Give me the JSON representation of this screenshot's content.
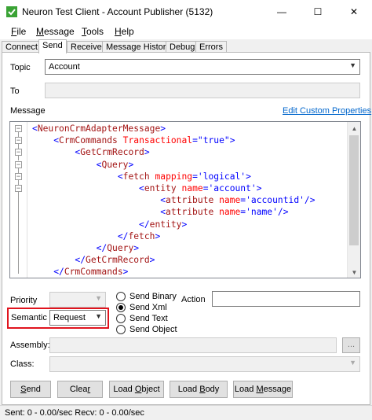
{
  "window": {
    "title": "Neuron Test Client - Account Publisher (5132)",
    "min_glyph": "—",
    "max_glyph": "☐",
    "close_glyph": "✕"
  },
  "menu": [
    {
      "label": "File",
      "key": "F",
      "rest": "ile"
    },
    {
      "label": "Message",
      "key": "M",
      "rest": "essage"
    },
    {
      "label": "Tools",
      "key": "T",
      "rest": "ools"
    },
    {
      "label": "Help",
      "key": "H",
      "rest": "elp"
    }
  ],
  "tabs": [
    "Connect",
    "Send",
    "Receive",
    "Message History",
    "Debug",
    "Errors"
  ],
  "active_tab": "Send",
  "form": {
    "topic_label": "Topic",
    "topic_value": "Account",
    "to_label": "To",
    "message_label": "Message",
    "edit_link": "Edit Custom Properties",
    "priority_label": "Priority",
    "semantic_label": "Semantic",
    "semantic_value": "Request",
    "action_label": "Action",
    "assembly_label": "Assembly:",
    "class_label": "Class:",
    "browse_label": "..."
  },
  "send_options": [
    {
      "label": "Send Binary",
      "checked": false
    },
    {
      "label": "Send Xml",
      "checked": true
    },
    {
      "label": "Send Text",
      "checked": false
    },
    {
      "label": "Send Object",
      "checked": false
    }
  ],
  "xml_lines": [
    {
      "indent": 0,
      "tokens": [
        [
          "tb",
          "<"
        ],
        [
          "tn",
          "NeuronCrmAdapterMessage"
        ],
        [
          "tb",
          ">"
        ]
      ]
    },
    {
      "indent": 1,
      "tokens": [
        [
          "tb",
          "<"
        ],
        [
          "tn",
          "CrmCommands"
        ],
        [
          "tx",
          " "
        ],
        [
          "an",
          "Transactional"
        ],
        [
          "tb",
          "=\""
        ],
        [
          "av",
          "true"
        ],
        [
          "tb",
          "\">"
        ]
      ]
    },
    {
      "indent": 2,
      "tokens": [
        [
          "tb",
          "<"
        ],
        [
          "tn",
          "GetCrmRecord"
        ],
        [
          "tb",
          ">"
        ]
      ]
    },
    {
      "indent": 3,
      "tokens": [
        [
          "tb",
          "<"
        ],
        [
          "tn",
          "Query"
        ],
        [
          "tb",
          ">"
        ]
      ]
    },
    {
      "indent": 4,
      "tokens": [
        [
          "tb",
          "<"
        ],
        [
          "tn",
          "fetch"
        ],
        [
          "tx",
          " "
        ],
        [
          "an",
          "mapping"
        ],
        [
          "tb",
          "='"
        ],
        [
          "av",
          "logical"
        ],
        [
          "tb",
          "'>"
        ]
      ]
    },
    {
      "indent": 5,
      "tokens": [
        [
          "tb",
          "<"
        ],
        [
          "tn",
          "entity"
        ],
        [
          "tx",
          " "
        ],
        [
          "an",
          "name"
        ],
        [
          "tb",
          "='"
        ],
        [
          "av",
          "account"
        ],
        [
          "tb",
          "'>"
        ]
      ]
    },
    {
      "indent": 6,
      "tokens": [
        [
          "tb",
          "<"
        ],
        [
          "tn",
          "attribute"
        ],
        [
          "tx",
          " "
        ],
        [
          "an",
          "name"
        ],
        [
          "tb",
          "='"
        ],
        [
          "av",
          "accountid"
        ],
        [
          "tb",
          "'/>"
        ]
      ]
    },
    {
      "indent": 6,
      "tokens": [
        [
          "tb",
          "<"
        ],
        [
          "tn",
          "attribute"
        ],
        [
          "tx",
          " "
        ],
        [
          "an",
          "name"
        ],
        [
          "tb",
          "='"
        ],
        [
          "av",
          "name"
        ],
        [
          "tb",
          "'/>"
        ]
      ]
    },
    {
      "indent": 5,
      "tokens": [
        [
          "tb",
          "</"
        ],
        [
          "tn",
          "entity"
        ],
        [
          "tb",
          ">"
        ]
      ]
    },
    {
      "indent": 4,
      "tokens": [
        [
          "tb",
          "</"
        ],
        [
          "tn",
          "fetch"
        ],
        [
          "tb",
          ">"
        ]
      ]
    },
    {
      "indent": 3,
      "tokens": [
        [
          "tb",
          "</"
        ],
        [
          "tn",
          "Query"
        ],
        [
          "tb",
          ">"
        ]
      ]
    },
    {
      "indent": 2,
      "tokens": [
        [
          "tb",
          "</"
        ],
        [
          "tn",
          "GetCrmRecord"
        ],
        [
          "tb",
          ">"
        ]
      ]
    },
    {
      "indent": 1,
      "tokens": [
        [
          "tb",
          "</"
        ],
        [
          "tn",
          "CrmCommands"
        ],
        [
          "tb",
          ">"
        ]
      ]
    }
  ],
  "buttons": [
    {
      "name": "send-button",
      "label": "Send",
      "key": "S",
      "rest": "end"
    },
    {
      "name": "clear-button",
      "label": "Clear",
      "pre": "Clea",
      "key": "r",
      "rest": ""
    },
    {
      "name": "load-object-button",
      "label": "Load Object",
      "pre": "Load ",
      "key": "O",
      "rest": "bject"
    },
    {
      "name": "load-body-button",
      "label": "Load Body",
      "pre": "Load ",
      "key": "B",
      "rest": "ody"
    },
    {
      "name": "load-message-button",
      "label": "Load Message",
      "pre": "Load ",
      "key": "M",
      "rest": "essage"
    }
  ],
  "status": {
    "text": "Sent: 0  -  0.00/sec  Recv: 0  -  0.00/sec"
  },
  "colors": {
    "highlight": "#e0141e",
    "link": "#0066cc"
  }
}
